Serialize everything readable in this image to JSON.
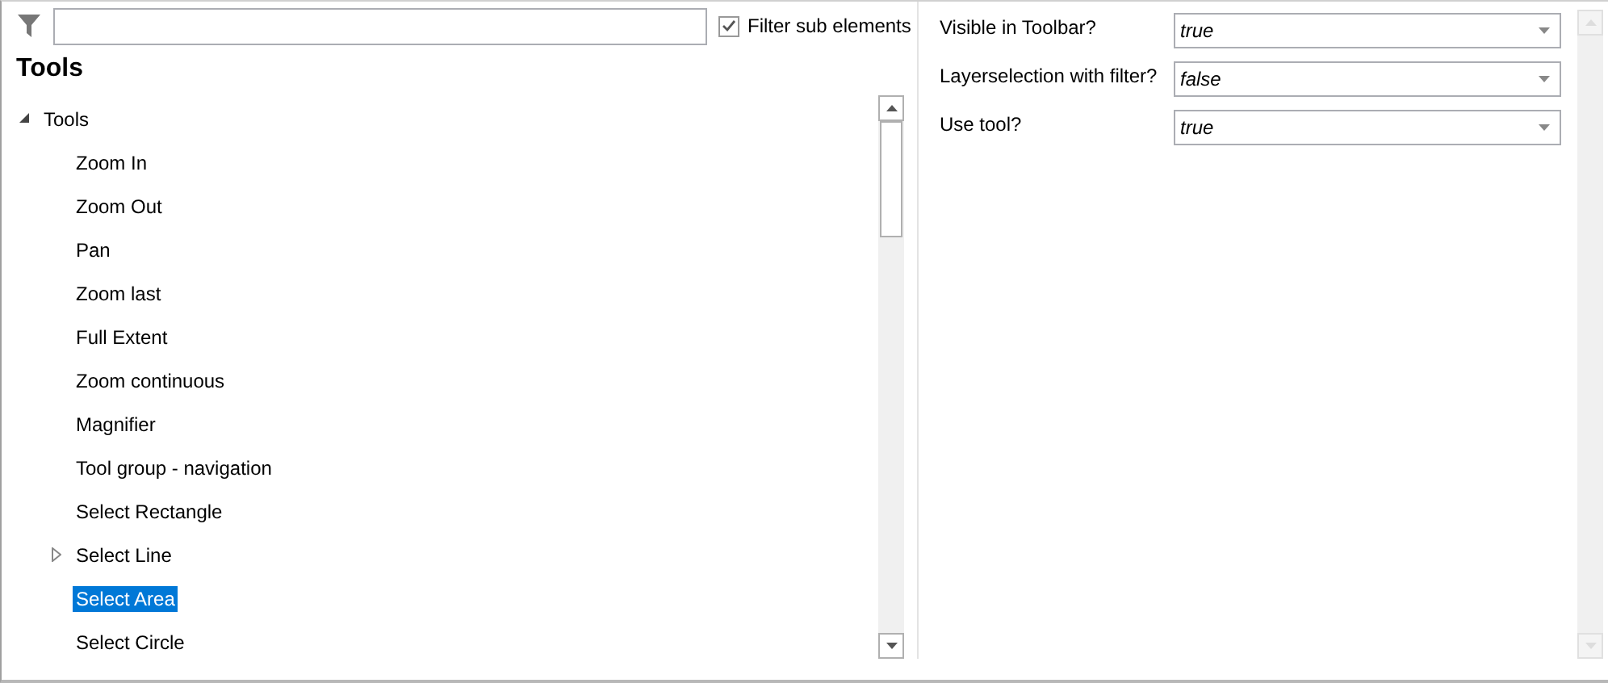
{
  "filter_sub_elements": {
    "label": "Filter sub elements",
    "checked": true
  },
  "heading": "Tools",
  "tree": {
    "label": "Tools",
    "expanded": true,
    "children": [
      {
        "label": "Zoom In",
        "selected": false,
        "expandable": false
      },
      {
        "label": "Zoom Out",
        "selected": false,
        "expandable": false
      },
      {
        "label": "Pan",
        "selected": false,
        "expandable": false
      },
      {
        "label": "Zoom last",
        "selected": false,
        "expandable": false
      },
      {
        "label": "Full Extent",
        "selected": false,
        "expandable": false
      },
      {
        "label": "Zoom continuous",
        "selected": false,
        "expandable": false
      },
      {
        "label": "Magnifier",
        "selected": false,
        "expandable": false
      },
      {
        "label": "Tool group - navigation",
        "selected": false,
        "expandable": false
      },
      {
        "label": "Select Rectangle",
        "selected": false,
        "expandable": false
      },
      {
        "label": "Select Line",
        "selected": false,
        "expandable": true
      },
      {
        "label": "Select Area",
        "selected": true,
        "expandable": false
      },
      {
        "label": "Select Circle",
        "selected": false,
        "expandable": false
      }
    ]
  },
  "properties": [
    {
      "label": "Visible in Toolbar?",
      "value": "true"
    },
    {
      "label": "Layerselection with filter?",
      "value": "false"
    },
    {
      "label": "Use tool?",
      "value": "true"
    }
  ]
}
